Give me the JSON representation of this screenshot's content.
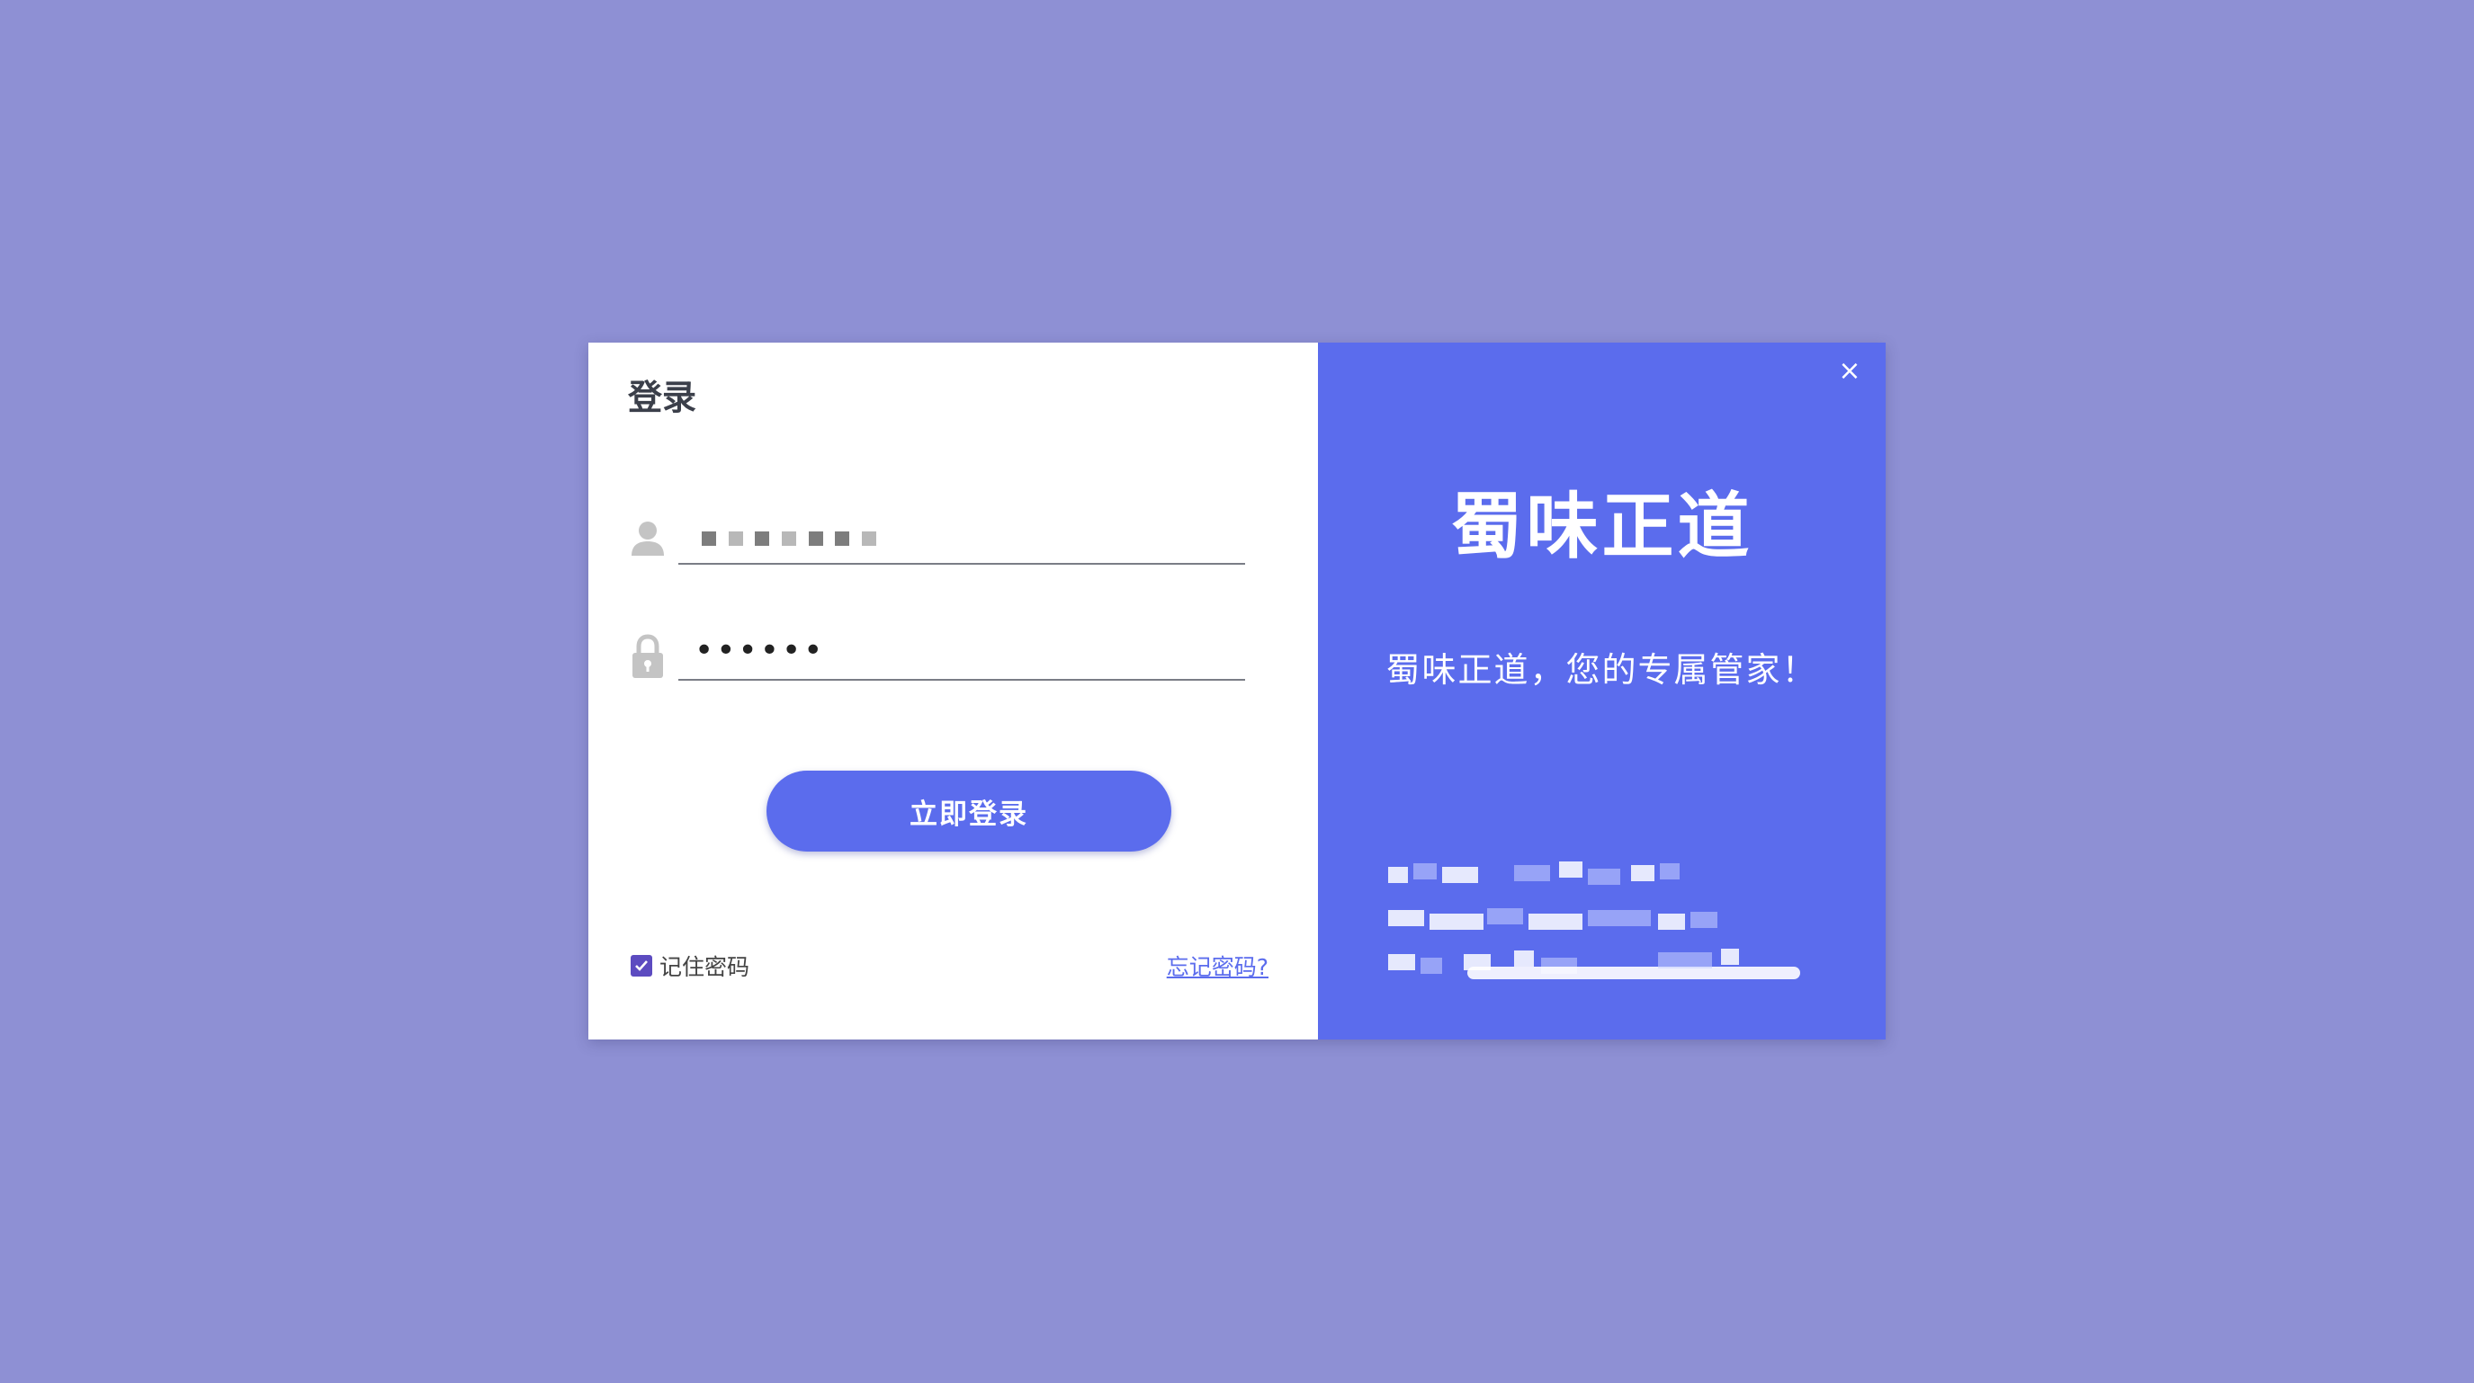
{
  "login": {
    "title": "登录",
    "username_value": "",
    "password_mask": "••••••",
    "submit_label": "立即登录",
    "remember_label": "记住密码",
    "remember_checked": true,
    "forgot_label": "忘记密码?"
  },
  "brand_panel": {
    "close_symbol": "×",
    "brand_name": "蜀味正道",
    "slogan": "蜀味正道，您的专属管家！"
  },
  "colors": {
    "background": "#8e90d4",
    "accent": "#5b6ced",
    "checkbox": "#5c4bc0"
  },
  "icons": {
    "user": "user-icon",
    "lock": "lock-icon",
    "close": "close-icon",
    "check": "check-icon"
  }
}
